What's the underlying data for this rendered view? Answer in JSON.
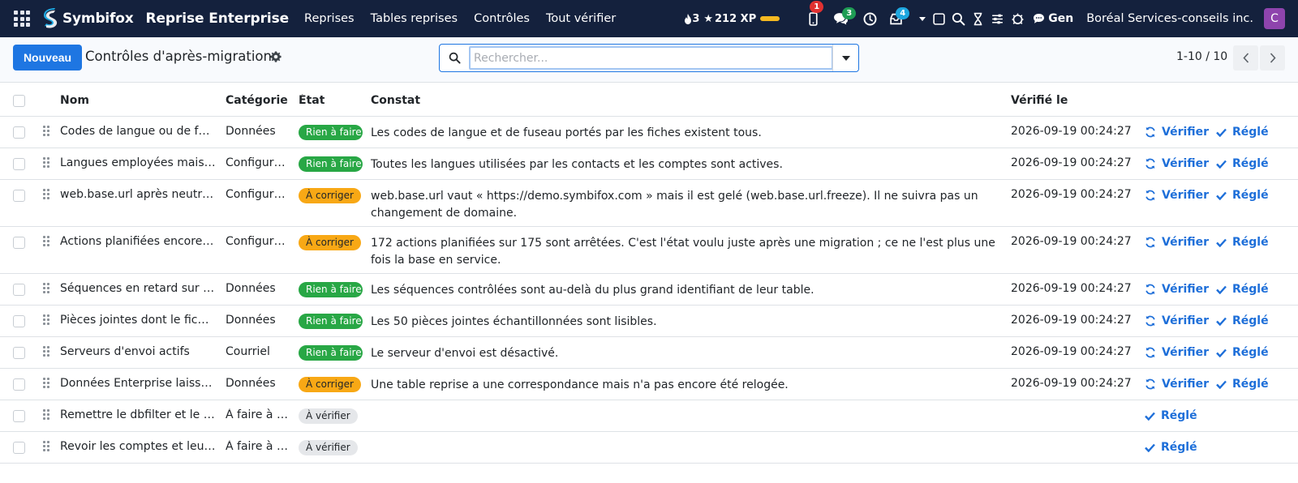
{
  "navbar": {
    "brand": "Symbifox",
    "app_title": "Reprise Enterprise",
    "menu": [
      "Reprises",
      "Tables reprises",
      "Contrôles",
      "Tout vérifier"
    ],
    "streak": "3",
    "xp": "212 XP",
    "phone_badge": "1",
    "chat_badge": "3",
    "activity_badge": "4",
    "gen_label": "Gen",
    "company": "Boréal Services-conseils inc.",
    "avatar_letter": "C"
  },
  "control": {
    "new_button": "Nouveau",
    "title": "Contrôles d'après-migration",
    "search_placeholder": "Rechercher...",
    "pager": "1-10 / 10"
  },
  "table": {
    "headers": {
      "nom": "Nom",
      "categorie": "Catégorie",
      "etat": "État",
      "constat": "Constat",
      "verifie": "Vérifié le"
    },
    "verify_label": "Vérifier",
    "settled_label": "Réglé",
    "rows": [
      {
        "nom": "Codes de langue ou de fuseau",
        "categorie": "Données",
        "etat": "Rien à faire",
        "etat_style": "green",
        "constat": "Les codes de langue et de fuseau portés par les fiches existent tous.",
        "date": "2026-09-19 00:24:27",
        "verify": true
      },
      {
        "nom": "Langues employées mais inactives",
        "categorie": "Configuration",
        "etat": "Rien à faire",
        "etat_style": "green",
        "constat": "Toutes les langues utilisées par les contacts et les comptes sont actives.",
        "date": "2026-09-19 00:24:27",
        "verify": true
      },
      {
        "nom": "web.base.url après neutralisation",
        "categorie": "Configuration",
        "etat": "À corriger",
        "etat_style": "orange",
        "constat": "web.base.url vaut « https://demo.symbifox.com » mais il est gelé (web.base.url.freeze). Il ne suivra pas un changement de domaine.",
        "date": "2026-09-19 00:24:27",
        "verify": true
      },
      {
        "nom": "Actions planifiées encore arrêtées",
        "categorie": "Configuration",
        "etat": "À corriger",
        "etat_style": "orange",
        "constat": "172 actions planifiées sur 175 sont arrêtées. C'est l'état voulu juste après une migration ; ce ne l'est plus une fois la base en service.",
        "date": "2026-09-19 00:24:27",
        "verify": true
      },
      {
        "nom": "Séquences en retard sur leur table",
        "categorie": "Données",
        "etat": "Rien à faire",
        "etat_style": "green",
        "constat": "Les séquences contrôlées sont au-delà du plus grand identifiant de leur table.",
        "date": "2026-09-19 00:24:27",
        "verify": true
      },
      {
        "nom": "Pièces jointes dont le fichier manque",
        "categorie": "Données",
        "etat": "Rien à faire",
        "etat_style": "green",
        "constat": "Les 50 pièces jointes échantillonnées sont lisibles.",
        "date": "2026-09-19 00:24:27",
        "verify": true
      },
      {
        "nom": "Serveurs d'envoi actifs",
        "categorie": "Courriel",
        "etat": "Rien à faire",
        "etat_style": "green",
        "constat": "Le serveur d'envoi est désactivé.",
        "date": "2026-09-19 00:24:27",
        "verify": true
      },
      {
        "nom": "Données Enterprise laissées",
        "categorie": "Données",
        "etat": "À corriger",
        "etat_style": "orange",
        "constat": "Une table reprise a une correspondance mais n'a pas encore été relogée.",
        "date": "2026-09-19 00:24:27",
        "verify": true
      },
      {
        "nom": "Remettre le dbfilter et le multi-base",
        "categorie": "À faire à la main",
        "etat": "À vérifier",
        "etat_style": "grey",
        "constat": "",
        "date": "",
        "verify": false
      },
      {
        "nom": "Revoir les comptes et leurs accès",
        "categorie": "À faire à la main",
        "etat": "À vérifier",
        "etat_style": "grey",
        "constat": "",
        "date": "",
        "verify": false
      }
    ]
  }
}
